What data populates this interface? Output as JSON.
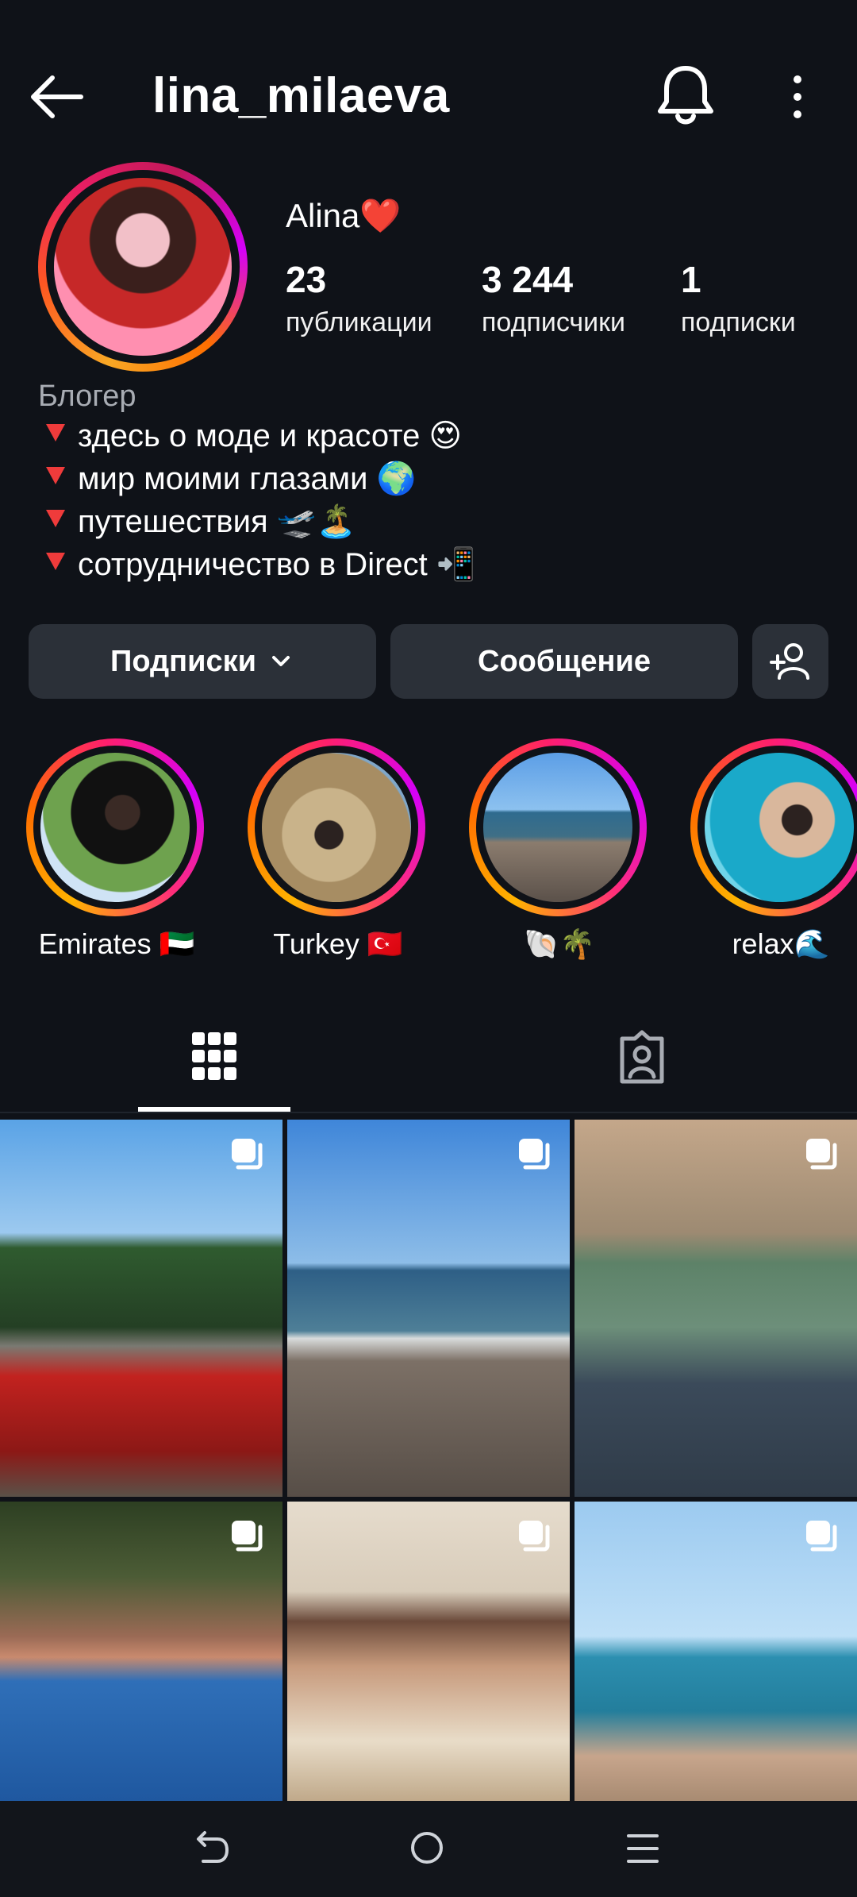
{
  "header": {
    "username": "lina_milaeva",
    "back_icon": "arrow-left-icon",
    "bell_icon": "bell-icon",
    "more_icon": "more-vertical-icon"
  },
  "profile": {
    "display_name": "Alina❤️",
    "stats": [
      {
        "value": "23",
        "label": "публикации"
      },
      {
        "value": "3 244",
        "label": "подписчики"
      },
      {
        "value": "1",
        "label": "подписки"
      }
    ],
    "category": "Блогер",
    "bio": [
      "здесь о моде и красоте 😍",
      "мир моими глазами 🌍",
      "путешествия 🛫🏝️",
      "сотрудничество в Direct 📲"
    ]
  },
  "actions": {
    "following_label": "Подписки",
    "message_label": "Сообщение",
    "add_icon": "add-person-icon"
  },
  "highlights": [
    {
      "label": "Emirates 🇦🇪"
    },
    {
      "label": "Turkey 🇹🇷"
    },
    {
      "label": "🐚🌴"
    },
    {
      "label": "relax🌊"
    }
  ],
  "tabs": {
    "posts_icon": "grid-icon",
    "tagged_icon": "tagged-person-icon"
  },
  "posts": [
    {
      "id": "post-1",
      "multi": true
    },
    {
      "id": "post-2",
      "multi": true
    },
    {
      "id": "post-3",
      "multi": true
    },
    {
      "id": "post-4",
      "multi": true
    },
    {
      "id": "post-5",
      "multi": true
    },
    {
      "id": "post-6",
      "multi": true
    }
  ],
  "colors": {
    "background": "#0f1218",
    "button": "#2b3038",
    "story_ring_start": "#ffb300",
    "story_ring_end": "#d500f9"
  }
}
